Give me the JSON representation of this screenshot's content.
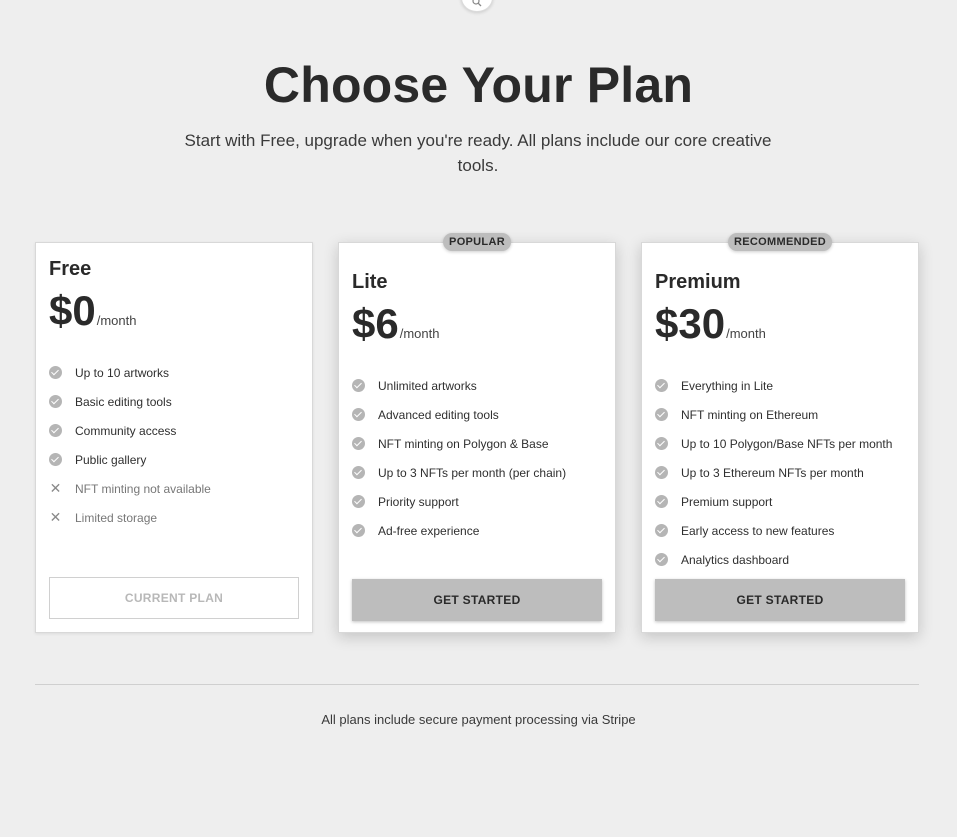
{
  "header": {
    "title": "Choose Your Plan",
    "subtitle": "Start with Free, upgrade when you're ready. All plans include our core creative tools."
  },
  "plans": [
    {
      "name": "Free",
      "price": "$0",
      "period": "/month",
      "features": [
        {
          "text": "Up to 10 artworks",
          "included": true
        },
        {
          "text": "Basic editing tools",
          "included": true
        },
        {
          "text": "Community access",
          "included": true
        },
        {
          "text": "Public gallery",
          "included": true
        },
        {
          "text": "NFT minting not available",
          "included": false
        },
        {
          "text": "Limited storage",
          "included": false
        }
      ],
      "button": "CURRENT PLAN"
    },
    {
      "name": "Lite",
      "badge": "POPULAR",
      "price": "$6",
      "period": "/month",
      "features": [
        {
          "text": "Unlimited artworks",
          "included": true
        },
        {
          "text": "Advanced editing tools",
          "included": true
        },
        {
          "text": "NFT minting on Polygon & Base",
          "included": true
        },
        {
          "text": "Up to 3 NFTs per month (per chain)",
          "included": true
        },
        {
          "text": "Priority support",
          "included": true
        },
        {
          "text": "Ad-free experience",
          "included": true
        }
      ],
      "button": "GET STARTED"
    },
    {
      "name": "Premium",
      "badge": "RECOMMENDED",
      "price": "$30",
      "period": "/month",
      "features": [
        {
          "text": "Everything in Lite",
          "included": true
        },
        {
          "text": "NFT minting on Ethereum",
          "included": true
        },
        {
          "text": "Up to 10 Polygon/Base NFTs per month",
          "included": true
        },
        {
          "text": "Up to 3 Ethereum NFTs per month",
          "included": true
        },
        {
          "text": "Premium support",
          "included": true
        },
        {
          "text": "Early access to new features",
          "included": true
        },
        {
          "text": "Analytics dashboard",
          "included": true
        }
      ],
      "button": "GET STARTED"
    }
  ],
  "footer": {
    "text": "All plans include secure payment processing via Stripe"
  },
  "icons": {
    "top": "search-icon",
    "included": "check-circle-icon",
    "excluded": "x-icon"
  },
  "colors": {
    "background": "#eeeeee",
    "accent": "#bdbdbd",
    "text": "#2a2a2a"
  }
}
